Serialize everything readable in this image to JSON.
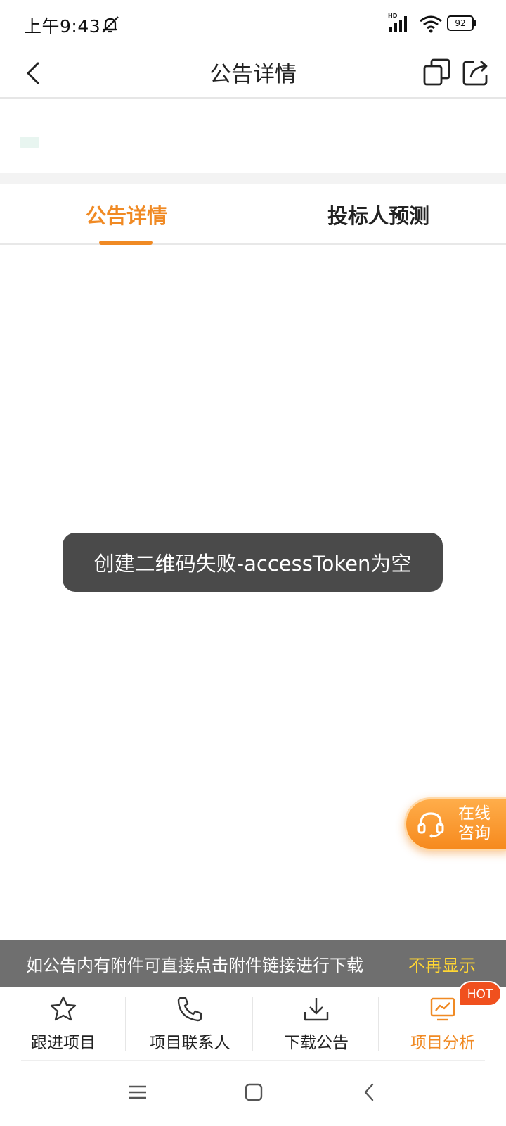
{
  "status_bar": {
    "time": "上午9:43",
    "network_badge": "HD",
    "battery": "92"
  },
  "nav": {
    "title": "公告详情"
  },
  "tabs": [
    {
      "label": "公告详情",
      "active": true
    },
    {
      "label": "投标人预测",
      "active": false
    }
  ],
  "toast": {
    "message": "创建二维码失败-accessToken为空"
  },
  "consult": {
    "label_line1": "在线",
    "label_line2": "咨询"
  },
  "notice": {
    "text": "如公告内有附件可直接点击附件链接进行下载",
    "dismiss_label": "不再显示"
  },
  "toolbar": {
    "items": [
      {
        "label": "跟进项目",
        "icon": "star-icon"
      },
      {
        "label": "项目联系人",
        "icon": "phone-icon"
      },
      {
        "label": "下载公告",
        "icon": "download-icon"
      },
      {
        "label": "项目分析",
        "icon": "analysis-icon",
        "active": true
      }
    ],
    "hot_badge": "HOT"
  },
  "colors": {
    "accent": "#f08a24",
    "notice_bg": "#6f6f6f",
    "dismiss": "#ffd633",
    "toast_bg": "#4a4a4a",
    "hot": "#f0501e"
  }
}
